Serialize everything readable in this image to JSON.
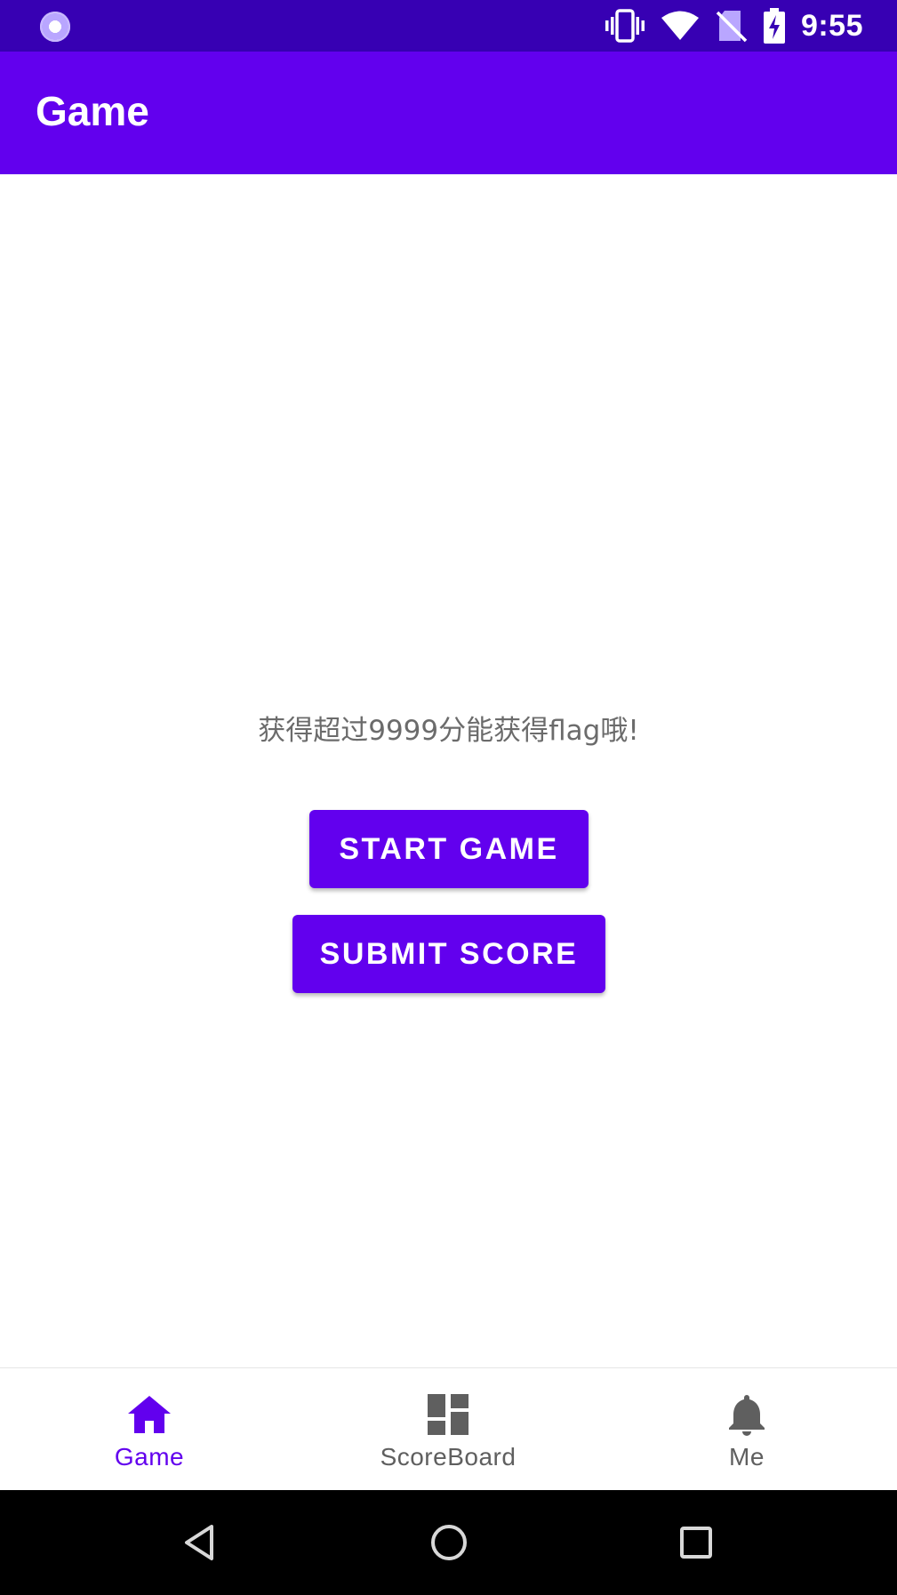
{
  "status_bar": {
    "time": "9:55",
    "icons": [
      "vibrate-icon",
      "wifi-icon",
      "no-sim-icon",
      "battery-charging-icon"
    ],
    "background_color": "#3700B3"
  },
  "app_bar": {
    "title": "Game",
    "background_color": "#6200EE"
  },
  "main": {
    "hint_text": "获得超过9999分能获得flag哦!",
    "start_button_label": "START GAME",
    "submit_button_label": "SUBMIT SCORE",
    "button_color": "#6200EE"
  },
  "bottom_nav": {
    "items": [
      {
        "label": "Game",
        "icon": "home-icon",
        "active": true
      },
      {
        "label": "ScoreBoard",
        "icon": "dashboard-icon",
        "active": false
      },
      {
        "label": "Me",
        "icon": "bell-icon",
        "active": false
      }
    ],
    "active_color": "#6200EE",
    "inactive_color": "#5f5f5f"
  },
  "system_nav": {
    "buttons": [
      "back-icon",
      "home-circle-icon",
      "recents-icon"
    ]
  }
}
